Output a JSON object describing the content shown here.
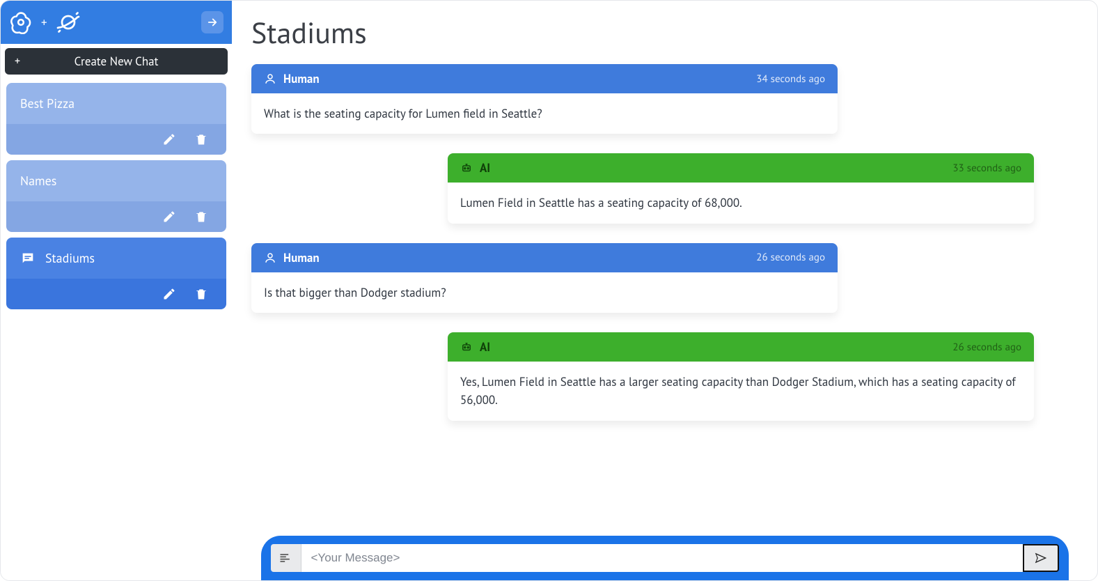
{
  "page": {
    "title": "Stadiums"
  },
  "newChat": {
    "label": "Create New Chat"
  },
  "sidebar": {
    "items": [
      {
        "label": "Best Pizza",
        "active": false
      },
      {
        "label": "Names",
        "active": false
      },
      {
        "label": "Stadiums",
        "active": true
      }
    ]
  },
  "roles": {
    "human": "Human",
    "ai": "AI"
  },
  "messages": [
    {
      "role": "human",
      "time": "34 seconds ago",
      "body": "What is the seating capacity for Lumen field in Seattle?"
    },
    {
      "role": "ai",
      "time": "33 seconds ago",
      "body": "Lumen Field in Seattle has a seating capacity of 68,000."
    },
    {
      "role": "human",
      "time": "26 seconds ago",
      "body": "Is that bigger than Dodger stadium?"
    },
    {
      "role": "ai",
      "time": "26 seconds ago",
      "body": "Yes, Lumen Field in Seattle has a larger seating capacity than Dodger Stadium, which has a seating capacity of 56,000."
    }
  ],
  "composer": {
    "placeholder": "<Your Message>"
  }
}
